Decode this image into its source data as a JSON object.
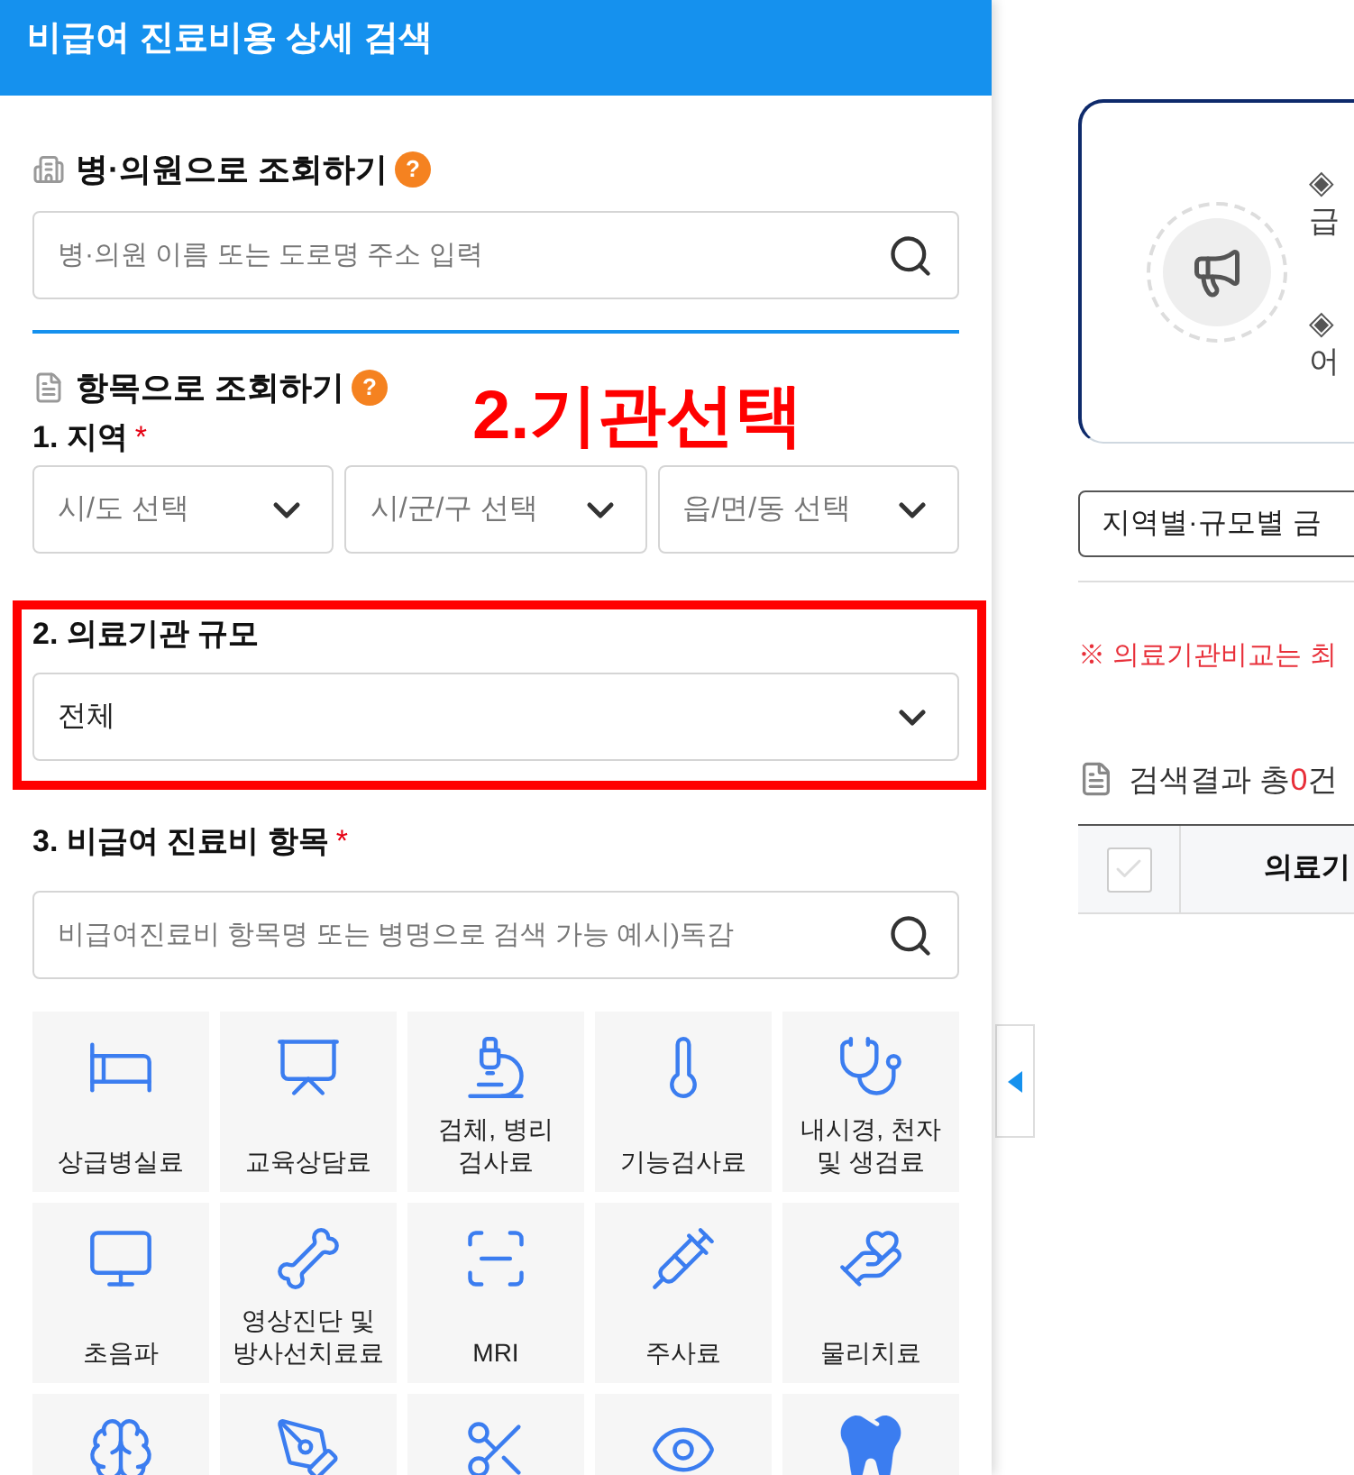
{
  "panel": {
    "title": "비급여 진료비용 상세 검색",
    "hospital_search": {
      "heading": "병·의원으로 조회하기",
      "help": "?",
      "placeholder": "병·의원 이름 또는 도로명 주소 입력"
    },
    "item_search": {
      "heading": "항목으로 조회하기",
      "help": "?",
      "region": {
        "label": "1. 지역",
        "required": "*",
        "selects": [
          {
            "placeholder": "시/도 선택"
          },
          {
            "placeholder": "시/군/구 선택"
          },
          {
            "placeholder": "읍/면/동 선택"
          }
        ]
      },
      "scale": {
        "label": "2. 의료기관 규모",
        "value": "전체"
      },
      "items": {
        "label": "3. 비급여 진료비 항목",
        "required": "*",
        "placeholder": "비급여진료비 항목명 또는 병명으로 검색 가능 예시)독감",
        "tiles": [
          {
            "kind": "labeled",
            "label": "상급병실료"
          },
          {
            "kind": "labeled",
            "label": "교육상담료"
          },
          {
            "kind": "labeled",
            "label": "검체, 병리\n검사료"
          },
          {
            "kind": "labeled",
            "label": "기능검사료"
          },
          {
            "kind": "labeled",
            "label": "내시경, 천자\n및 생검료"
          },
          {
            "kind": "labeled",
            "label": "초음파"
          },
          {
            "kind": "labeled",
            "label": "영상진단 및\n방사선치료료"
          },
          {
            "kind": "labeled",
            "label": "MRI"
          },
          {
            "kind": "labeled",
            "label": "주사료"
          },
          {
            "kind": "labeled",
            "label": "물리치료"
          },
          {
            "kind": "cut"
          },
          {
            "kind": "cut"
          },
          {
            "kind": "cut"
          },
          {
            "kind": "cut"
          },
          {
            "kind": "cut"
          }
        ]
      }
    }
  },
  "annotation": {
    "text": "2.기관선택"
  },
  "info_card": {
    "lines": [
      {
        "bullet": "◈",
        "text": "급"
      },
      {
        "bullet": "◈",
        "text": "어"
      }
    ]
  },
  "compare_button": "지역별·규모별 금",
  "notice": "※ 의료기관비교는 최",
  "results": {
    "prefix": "검색결과 총",
    "count": "0",
    "suffix": "건"
  },
  "table": {
    "select_all": {
      "checked": false
    },
    "columns": [
      {
        "label": "의료기"
      }
    ]
  }
}
